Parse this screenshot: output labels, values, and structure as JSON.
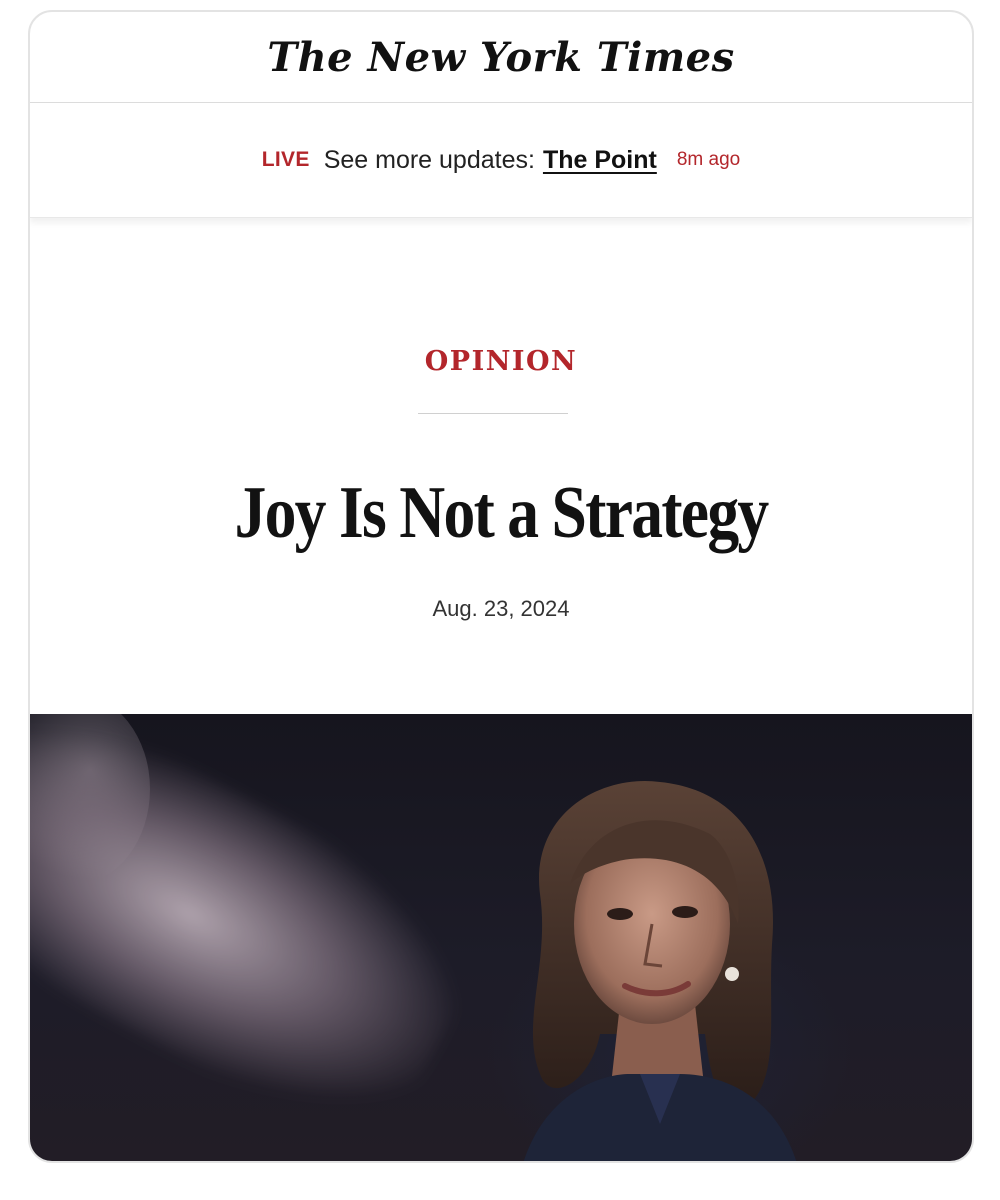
{
  "masthead": {
    "title": "The New York Times"
  },
  "live_bar": {
    "live_label": "LIVE",
    "text": "See more updates:",
    "link_label": "The Point",
    "time_ago": "8m ago"
  },
  "article": {
    "section": "OPINION",
    "headline": "Joy Is Not a Strategy",
    "date": "Aug. 23, 2024"
  },
  "colors": {
    "accent_red": "#b3262b",
    "text": "#121212"
  },
  "icons": [
    "woman-portrait-photo"
  ]
}
